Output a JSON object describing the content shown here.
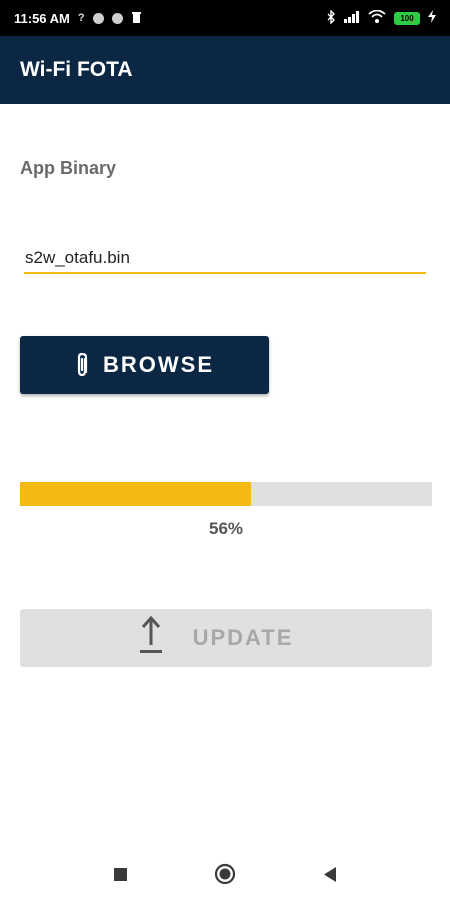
{
  "status_bar": {
    "time": "11:56 AM",
    "extra_icon": "?",
    "battery_level": "100",
    "icons": [
      "bluetooth-icon",
      "signal-icon",
      "wifi-icon",
      "battery-icon",
      "charging-icon"
    ]
  },
  "app_bar": {
    "title": "Wi-Fi FOTA"
  },
  "binary": {
    "label": "App Binary",
    "file_name": "s2w_otafu.bin"
  },
  "browse": {
    "label": "BROWSE",
    "icon": "paperclip-icon"
  },
  "progress": {
    "value": 0.56,
    "label": "56%"
  },
  "update": {
    "label": "UPDATE",
    "icon": "upload-icon",
    "enabled": false
  },
  "nav": {
    "icons": [
      "recents-icon",
      "home-icon",
      "back-icon"
    ]
  },
  "colors": {
    "primary": "#0b2744",
    "accent": "#f5b914",
    "disabled": "#e0e0e0"
  }
}
